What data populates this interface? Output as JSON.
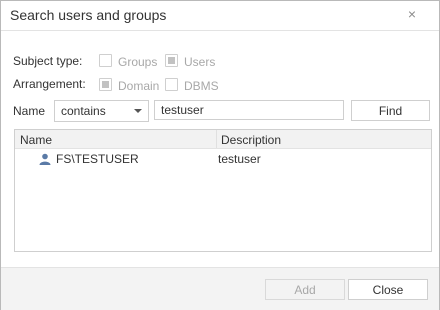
{
  "dialog": {
    "title": "Search users and groups",
    "close_glyph": "×"
  },
  "subject_type": {
    "label": "Subject type:",
    "options": [
      {
        "label": "Groups",
        "checked": false,
        "disabled": true
      },
      {
        "label": "Users",
        "checked": true,
        "disabled": true
      }
    ]
  },
  "arrangement": {
    "label": "Arrangement:",
    "options": [
      {
        "label": "Domain",
        "checked": true,
        "disabled": true
      },
      {
        "label": "DBMS",
        "checked": false,
        "disabled": true
      }
    ]
  },
  "search": {
    "name_label": "Name",
    "mode_value": "contains",
    "query_value": "testuser",
    "find_label": "Find"
  },
  "results": {
    "columns": [
      "Name",
      "Description"
    ],
    "rows": [
      {
        "name": "FS\\TESTUSER",
        "description": "testuser",
        "icon": "user-icon"
      }
    ]
  },
  "footer": {
    "add_label": "Add",
    "close_label": "Close"
  },
  "colors": {
    "border": "#cfcfcf",
    "disabled_text": "#a8a8a8",
    "user_icon": "#5a7aa6"
  }
}
